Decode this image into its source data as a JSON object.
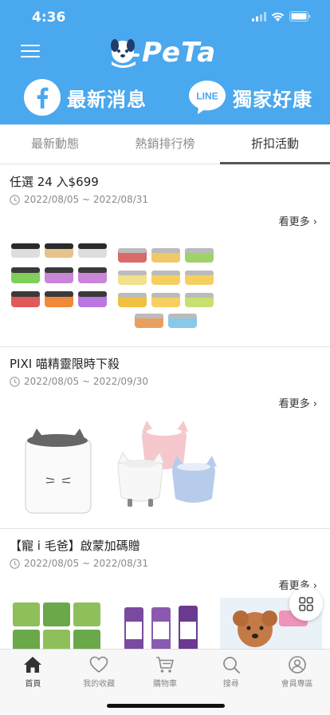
{
  "status_bar": {
    "time": "4:36"
  },
  "brand": {
    "logo_text": "PeTa"
  },
  "promo_links": {
    "facebook_label": "最新消息",
    "line_badge": "LINE",
    "line_label": "獨家好康"
  },
  "tabs": [
    {
      "label": "最新動態",
      "active": false
    },
    {
      "label": "熱銷排行榜",
      "active": false
    },
    {
      "label": "折扣活動",
      "active": true
    }
  ],
  "promotions": [
    {
      "title": "任選 24 入$699",
      "date_range": "2022/08/05 ~ 2022/08/31",
      "more_label": "看更多 ›"
    },
    {
      "title": "PIXI 喵精靈限時下殺",
      "date_range": "2022/08/05 ~ 2022/09/30",
      "more_label": "看更多 ›"
    },
    {
      "title": "【寵 i 毛爸】啟蒙加碼贈",
      "date_range": "2022/08/05 ~ 2022/08/31",
      "more_label": "看更多 ›"
    }
  ],
  "bottom_nav": [
    {
      "label": "首頁",
      "icon": "home-icon",
      "active": true
    },
    {
      "label": "我的收藏",
      "icon": "heart-icon",
      "active": false
    },
    {
      "label": "購物車",
      "icon": "cart-icon",
      "active": false
    },
    {
      "label": "搜尋",
      "icon": "search-icon",
      "active": false
    },
    {
      "label": "會員專區",
      "icon": "user-icon",
      "active": false
    }
  ],
  "colors": {
    "header": "#4aa8ee",
    "active_tab_underline": "#555555",
    "inactive_text": "#8b8b8b"
  }
}
